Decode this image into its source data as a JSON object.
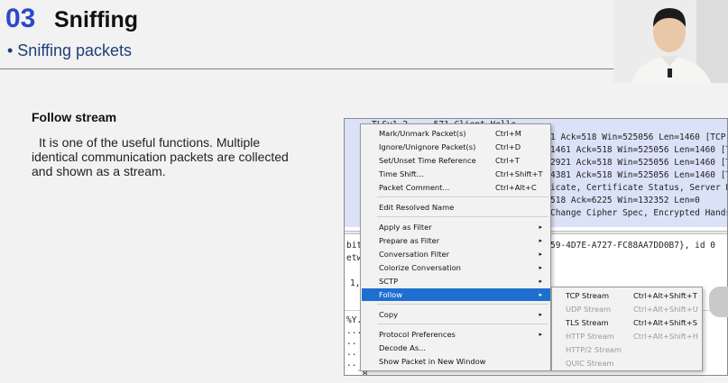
{
  "slide": {
    "number": "03",
    "title": "Sniffing",
    "subtitle": "• Sniffing packets",
    "section_heading": "Follow stream",
    "body": "It is one of the useful functions. Multiple identical communication packets are collected and shown as a stream."
  },
  "packet_list": {
    "rows": [
      "TLSv1.2     571 Client Hello",
      "1 Ack=518 Win=525056 Len=1460 [TCP",
      "1461 Ack=518 Win=525056 Len=1460 [T",
      "2921 Ack=518 Win=525056 Len=1460 [T",
      "4381 Ack=518 Win=525056 Len=1460 [T",
      "icate, Certificate Status, Server Ke",
      "518 Ack=6225 Win=132352 Len=0",
      "Change Cipher Spec, Encrypted Hands"
    ]
  },
  "packet_detail": {
    "rows": [
      "bit",
      "etw",
      "59-4D7E-A727-FC88AA7DD0B7}, id 0",
      "1,"
    ]
  },
  "packet_bytes": {
    "rows": [
      "%Y.",
      "...",
      "..",
      "..",
      "..",
      "..",
      "..",
      "¨8"
    ]
  },
  "context_menu": {
    "items": [
      {
        "label": "Mark/Unmark Packet(s)",
        "shortcut": "Ctrl+M",
        "arrow": ""
      },
      {
        "label": "Ignore/Unignore Packet(s)",
        "shortcut": "Ctrl+D",
        "arrow": ""
      },
      {
        "label": "Set/Unset Time Reference",
        "shortcut": "Ctrl+T",
        "arrow": ""
      },
      {
        "label": "Time Shift...",
        "shortcut": "Ctrl+Shift+T",
        "arrow": ""
      },
      {
        "label": "Packet Comment...",
        "shortcut": "Ctrl+Alt+C",
        "arrow": ""
      },
      {
        "label": "Edit Resolved Name",
        "shortcut": "",
        "arrow": ""
      },
      {
        "label": "Apply as Filter",
        "shortcut": "",
        "arrow": "▸"
      },
      {
        "label": "Prepare as Filter",
        "shortcut": "",
        "arrow": "▸"
      },
      {
        "label": "Conversation Filter",
        "shortcut": "",
        "arrow": "▸"
      },
      {
        "label": "Colorize Conversation",
        "shortcut": "",
        "arrow": "▸"
      },
      {
        "label": "SCTP",
        "shortcut": "",
        "arrow": "▸"
      },
      {
        "label": "Follow",
        "shortcut": "",
        "arrow": "▸"
      },
      {
        "label": "Copy",
        "shortcut": "",
        "arrow": "▸"
      },
      {
        "label": "Protocol Preferences",
        "shortcut": "",
        "arrow": "▸"
      },
      {
        "label": "Decode As...",
        "shortcut": "",
        "arrow": ""
      },
      {
        "label": "Show Packet in New Window",
        "shortcut": "",
        "arrow": ""
      }
    ]
  },
  "follow_submenu": {
    "items": [
      {
        "label": "TCP Stream",
        "shortcut": "Ctrl+Alt+Shift+T"
      },
      {
        "label": "UDP Stream",
        "shortcut": "Ctrl+Alt+Shift+U"
      },
      {
        "label": "TLS Stream",
        "shortcut": "Ctrl+Alt+Shift+S"
      },
      {
        "label": "HTTP Stream",
        "shortcut": "Ctrl+Alt+Shift+H"
      },
      {
        "label": "HTTP/2 Stream",
        "shortcut": ""
      },
      {
        "label": "QUIC Stream",
        "shortcut": ""
      }
    ]
  },
  "colors": {
    "accent": "#2c48c9",
    "selection": "#1f6fd0",
    "packet_list_bg": "#dbe2f8"
  }
}
